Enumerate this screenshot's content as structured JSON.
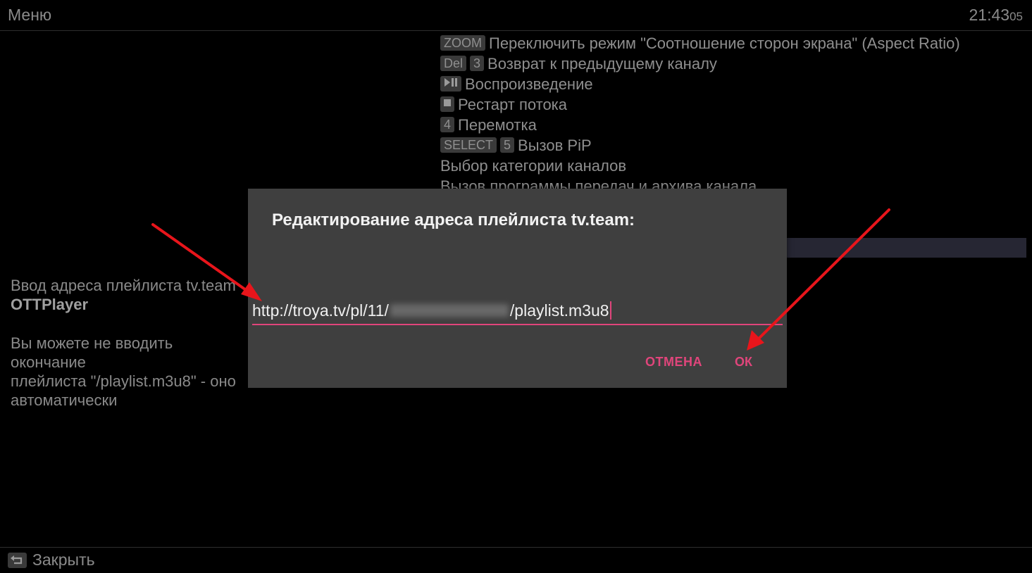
{
  "header": {
    "title": "Меню",
    "time_hm": "21:43",
    "time_sec": "05"
  },
  "hotkeys": [
    {
      "keys": [
        "ZOOM"
      ],
      "text": "Переключить режим \"Соотношение сторон экрана\" (Aspect Ratio)"
    },
    {
      "keys": [
        "Del",
        "3"
      ],
      "text": "Возврат к предыдущему каналу"
    },
    {
      "keys": [
        "play-pause-icon"
      ],
      "text": "Воспроизведение"
    },
    {
      "keys": [
        "stop-icon"
      ],
      "text": "Рестарт потока"
    },
    {
      "keys": [
        "4"
      ],
      "text": "Перемотка"
    },
    {
      "keys": [
        "SELECT",
        "5"
      ],
      "text": "Вызов PiP"
    },
    {
      "keys": [],
      "text": "Выбор категории каналов"
    },
    {
      "keys": [],
      "text": "Вызов программы передач и архива канала"
    }
  ],
  "left_info": {
    "line1": "Ввод адреса плейлиста tv.team",
    "line2": "OTTPlayer",
    "line3": "Вы можете не вводить окончание",
    "line4": "плейлиста \"/playlist.m3u8\" - оно",
    "line5": "автоматически"
  },
  "footer": {
    "close_label": "Закрыть"
  },
  "dialog": {
    "title": "Редактирование адреса плейлиста tv.team:",
    "value_prefix": "http://troya.tv/pl/11/",
    "value_suffix": "/playlist.m3u8",
    "cancel_label": "ОТМЕНА",
    "ok_label": "ОК"
  },
  "colors": {
    "accent": "#e0457b",
    "arrow": "#e8151b",
    "dialog_bg": "#3f3f3f"
  }
}
